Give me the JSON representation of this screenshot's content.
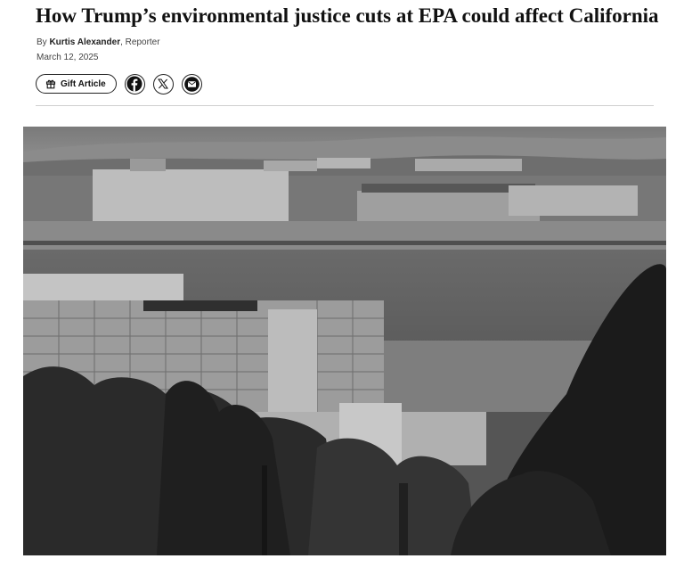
{
  "article": {
    "headline": "How Trump’s environmental justice cuts at EPA could affect California",
    "byline_prefix": "By",
    "author": "Kurtis Alexander",
    "author_role": "Reporter",
    "date": "March 12, 2025"
  },
  "share": {
    "gift_label": "Gift Article",
    "buttons": [
      {
        "name": "facebook",
        "icon": "facebook-icon"
      },
      {
        "name": "x",
        "icon": "x-icon"
      },
      {
        "name": "email",
        "icon": "mail-icon"
      }
    ]
  },
  "photo": {
    "subject": "black and white photo of waterfront construction with bay and hills"
  }
}
